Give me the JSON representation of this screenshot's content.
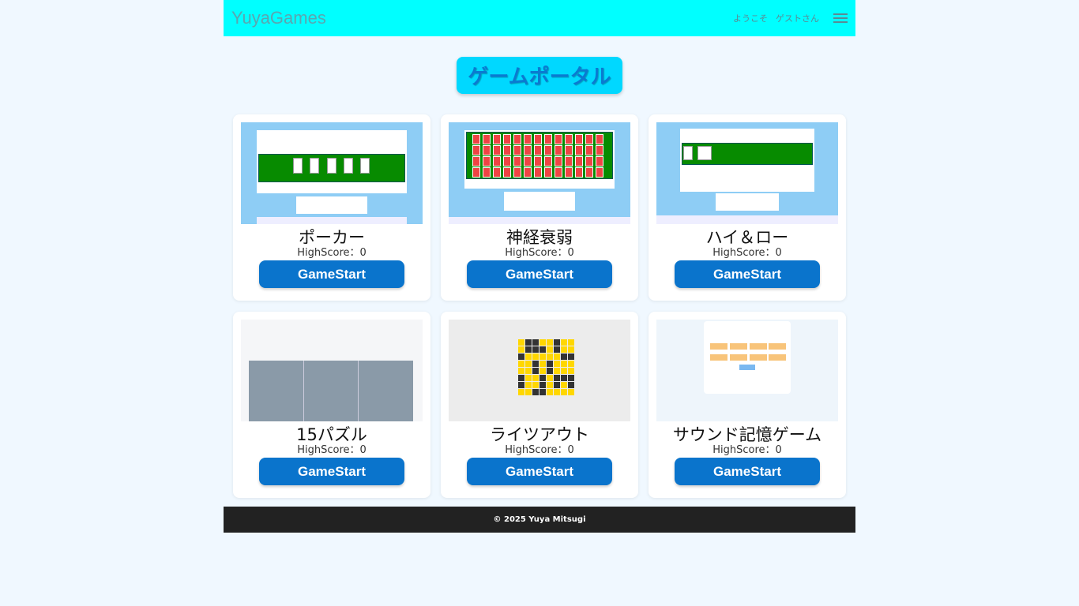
{
  "header": {
    "brand": "YuyaGames",
    "welcome": "ようこそ",
    "user": "ゲストさん"
  },
  "page_title": "ゲームポータル",
  "games": [
    {
      "name": "ポーカー",
      "score_label": "HighScore：0",
      "button": "GameStart"
    },
    {
      "name": "神経衰弱",
      "score_label": "HighScore：0",
      "button": "GameStart"
    },
    {
      "name": "ハイ＆ロー",
      "score_label": "HighScore：0",
      "button": "GameStart"
    },
    {
      "name": "15パズル",
      "score_label": "HighScore：0",
      "button": "GameStart"
    },
    {
      "name": "ライツアウト",
      "score_label": "HighScore：0",
      "button": "GameStart"
    },
    {
      "name": "サウンド記憶ゲーム",
      "score_label": "HighScore：0",
      "button": "GameStart"
    }
  ],
  "footer": "© 2025 Yuya Mitsugi",
  "colors": {
    "header_bg": "#00ffff",
    "title_bg": "#00d8ff",
    "button_bg": "#0a74cc",
    "footer_bg": "#222222",
    "page_bg": "#f0f8ff"
  },
  "icons": [
    "menu-icon"
  ]
}
